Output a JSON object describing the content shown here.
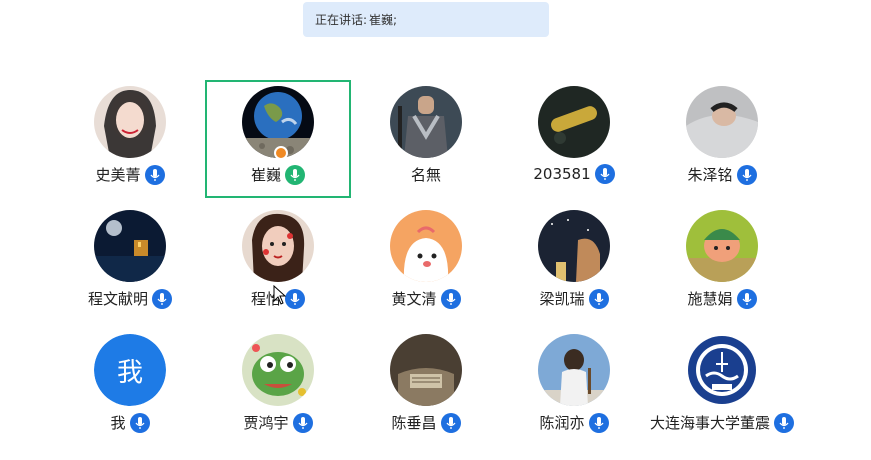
{
  "banner": {
    "label": "正在讲话:",
    "speaker": "崔巍;"
  },
  "participants": [
    {
      "name": "史美菁",
      "avatar": "photo-girl",
      "mic": "muted"
    },
    {
      "name": "崔巍",
      "avatar": "earth",
      "mic": "speaking",
      "host": true,
      "active": true
    },
    {
      "name": "名無",
      "avatar": "warrior",
      "mic": "none"
    },
    {
      "name": "203581",
      "avatar": "bottle",
      "mic": "muted"
    },
    {
      "name": "朱泽铭",
      "avatar": "sleeping",
      "mic": "muted"
    },
    {
      "name": "程文献明",
      "avatar": "night-sea",
      "mic": "muted"
    },
    {
      "name": "程怡",
      "avatar": "art-girl",
      "mic": "muted"
    },
    {
      "name": "黄文清",
      "avatar": "cartoon-dog",
      "mic": "muted"
    },
    {
      "name": "梁凯瑞",
      "avatar": "painting",
      "mic": "muted"
    },
    {
      "name": "施慧娟",
      "avatar": "cartoon-green",
      "mic": "muted"
    },
    {
      "name": "我",
      "avatar": "text",
      "avatar_text": "我",
      "mic": "muted"
    },
    {
      "name": "贾鸿宇",
      "avatar": "frog",
      "mic": "muted"
    },
    {
      "name": "陈垂昌",
      "avatar": "hands",
      "mic": "muted"
    },
    {
      "name": "陈润亦",
      "avatar": "man-sky",
      "mic": "muted"
    },
    {
      "name": "大连海事大学董震",
      "avatar": "logo",
      "mic": "muted"
    }
  ],
  "colors": {
    "accent": "#1e6fe0",
    "speaking": "#22b573",
    "active_border": "#22b573",
    "banner_bg": "#deebfb"
  }
}
